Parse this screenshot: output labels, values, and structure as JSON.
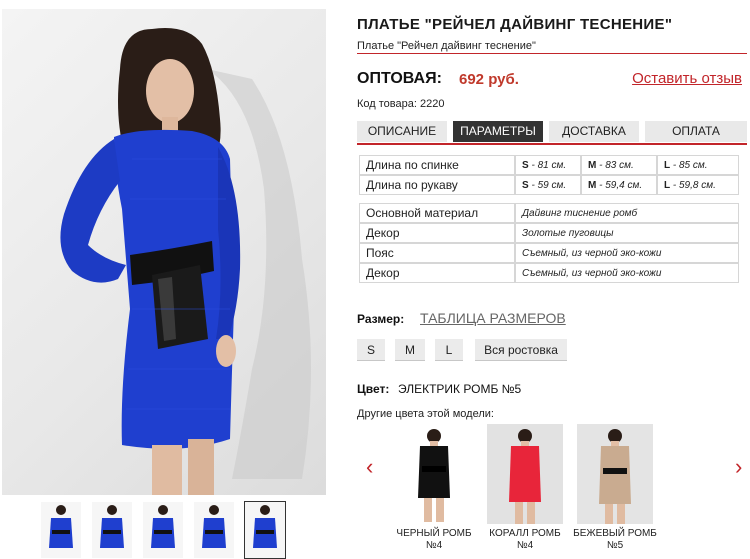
{
  "product": {
    "title": "ПЛАТЬЕ \"РЕЙЧЕЛ ДАЙВИНГ ТЕСНЕНИЕ\"",
    "subtitle": "Платье \"Рейчел дайвинг теснение\"",
    "price_label": "ОПТОВАЯ:",
    "price_value": "692 руб.",
    "review_link": "Оставить отзыв",
    "sku": "Код товара: 2220"
  },
  "tabs": [
    {
      "label": "ОПИСАНИЕ",
      "active": false
    },
    {
      "label": "ПАРАМЕТРЫ",
      "active": true
    },
    {
      "label": "ДОСТАВКА",
      "active": false
    },
    {
      "label": "ОПЛАТА",
      "active": false
    }
  ],
  "measurements": [
    {
      "name": "Длина по спинке",
      "s": "81 см.",
      "m": "83 см.",
      "l": "85 см."
    },
    {
      "name": "Длина по рукаву",
      "s": "59 см.",
      "m": "59,4 см.",
      "l": "59,8 см."
    }
  ],
  "size_letters": {
    "s": "S",
    "m": "M",
    "l": "L",
    "sep": " - "
  },
  "attributes": [
    {
      "name": "Основной материал",
      "value": "Дайвинг тиснение ромб"
    },
    {
      "name": "Декор",
      "value": "Золотые пуговицы"
    },
    {
      "name": "Пояс",
      "value": "Съемный, из черной эко-кожи"
    },
    {
      "name": "Декор",
      "value": "Съемный, из черной эко-кожи"
    }
  ],
  "size_selector": {
    "label": "Размер:",
    "table_link": "ТАБЛИЦА РАЗМЕРОВ",
    "buttons": [
      "S",
      "M",
      "L",
      "Вся ростовка"
    ]
  },
  "color": {
    "label": "Цвет:",
    "value": "ЭЛЕКТРИК РОМБ №5",
    "other_label": "Другие цвета этой модели:",
    "prev_arrow": "‹",
    "next_arrow": "›",
    "variants": [
      {
        "name": "ЧЕРНЫЙ РОМБ №4",
        "color": "#111111"
      },
      {
        "name": "КОРАЛЛ РОМБ №4",
        "color": "#e8253a"
      },
      {
        "name": "БЕЖЕВЫЙ РОМБ №5",
        "color": "#c9ab90"
      }
    ]
  },
  "colors": {
    "accent": "#c2252a",
    "price": "#c0392b",
    "dress_main": "#1f3fcf",
    "active_tab": "#333333"
  },
  "thumbnails": {
    "count": 5,
    "active_index": 4
  }
}
